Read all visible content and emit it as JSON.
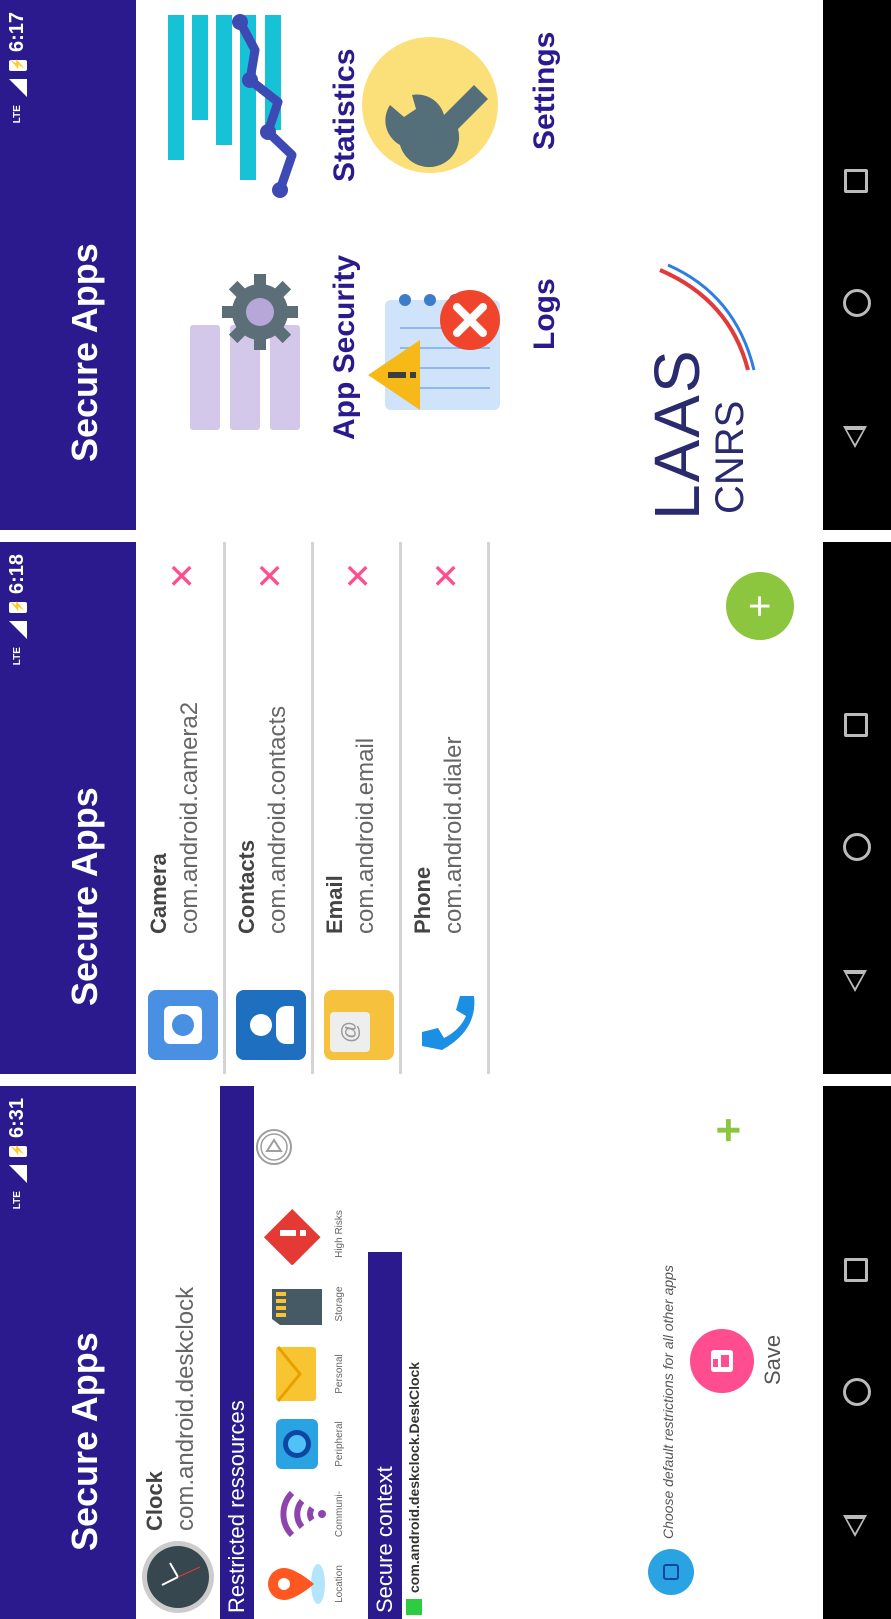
{
  "screens": [
    {
      "status": {
        "network": "LTE",
        "time": "6:17"
      },
      "title": "Secure Apps",
      "tiles": [
        "App Security",
        "Statistics",
        "Logs",
        "Settings"
      ],
      "logo": {
        "line1": "LAAS",
        "line2": "CNRS"
      }
    },
    {
      "status": {
        "network": "LTE",
        "time": "6:18"
      },
      "title": "Secure Apps",
      "apps": [
        {
          "name": "Camera",
          "package": "com.android.camera2",
          "remove": "✕"
        },
        {
          "name": "Contacts",
          "package": "com.android.contacts",
          "remove": "✕"
        },
        {
          "name": "Email",
          "package": "com.android.email",
          "remove": "✕"
        },
        {
          "name": "Phone",
          "package": "com.android.dialer",
          "remove": "✕"
        }
      ],
      "fab_label": "+"
    },
    {
      "status": {
        "network": "LTE",
        "time": "6:31"
      },
      "title": "Secure Apps",
      "app": {
        "name": "Clock",
        "package": "com.android.deskclock"
      },
      "restricted_header": "Restricted ressources",
      "resources": [
        "Location",
        "Communi-",
        "Peripheral",
        "Personal",
        "Storage",
        "High Risks"
      ],
      "context_header": "Secure context",
      "context_activity": "com.android.deskclock.DeskClock",
      "default_hint": "Choose default restrictions for all other apps",
      "save_label": "Save",
      "add_label": "+"
    }
  ],
  "colors": {
    "appbar": "#2a1a8e",
    "accent_pink": "#ff4d8f",
    "fab_green": "#8cc63f",
    "tile_text": "#2a1a8e"
  }
}
